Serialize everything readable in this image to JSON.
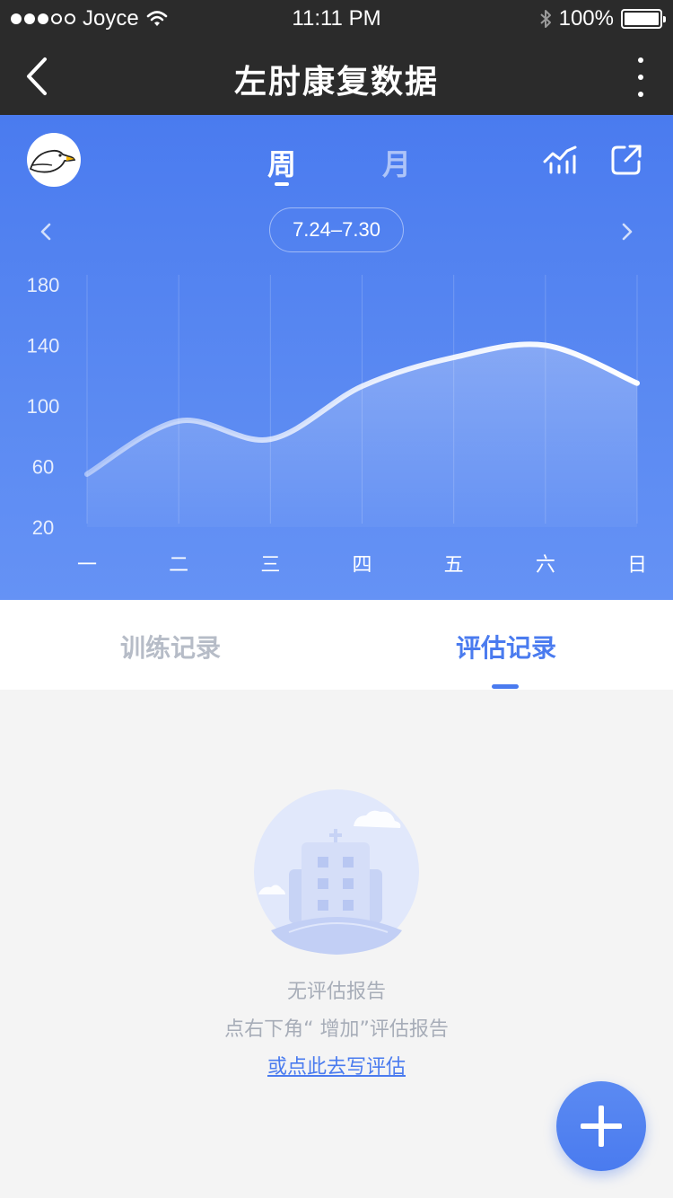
{
  "status_bar": {
    "carrier": "Joyce",
    "time": "11:11 PM",
    "battery": "100%"
  },
  "nav": {
    "title": "左肘康复数据"
  },
  "period_tabs": {
    "week": "周",
    "month": "月",
    "selected": "week"
  },
  "date_range": "7.24–7.30",
  "chart_data": {
    "type": "line",
    "x": [
      "一",
      "二",
      "三",
      "四",
      "五",
      "六",
      "日"
    ],
    "values": [
      55,
      90,
      78,
      113,
      132,
      140,
      115
    ],
    "y_ticks": [
      "180",
      "140",
      "100",
      "60",
      "20"
    ],
    "ylim": [
      20,
      180
    ],
    "grid": "vertical"
  },
  "record_tabs": {
    "training": "训练记录",
    "assessment": "评估记录",
    "selected": "assessment"
  },
  "empty_state": {
    "title": "无评估报告",
    "hint": "点右下角“ 增加”评估报告",
    "link": "或点此去写评估"
  },
  "colors": {
    "accent": "#4a7bef",
    "topbar": "#2b2b2b"
  }
}
